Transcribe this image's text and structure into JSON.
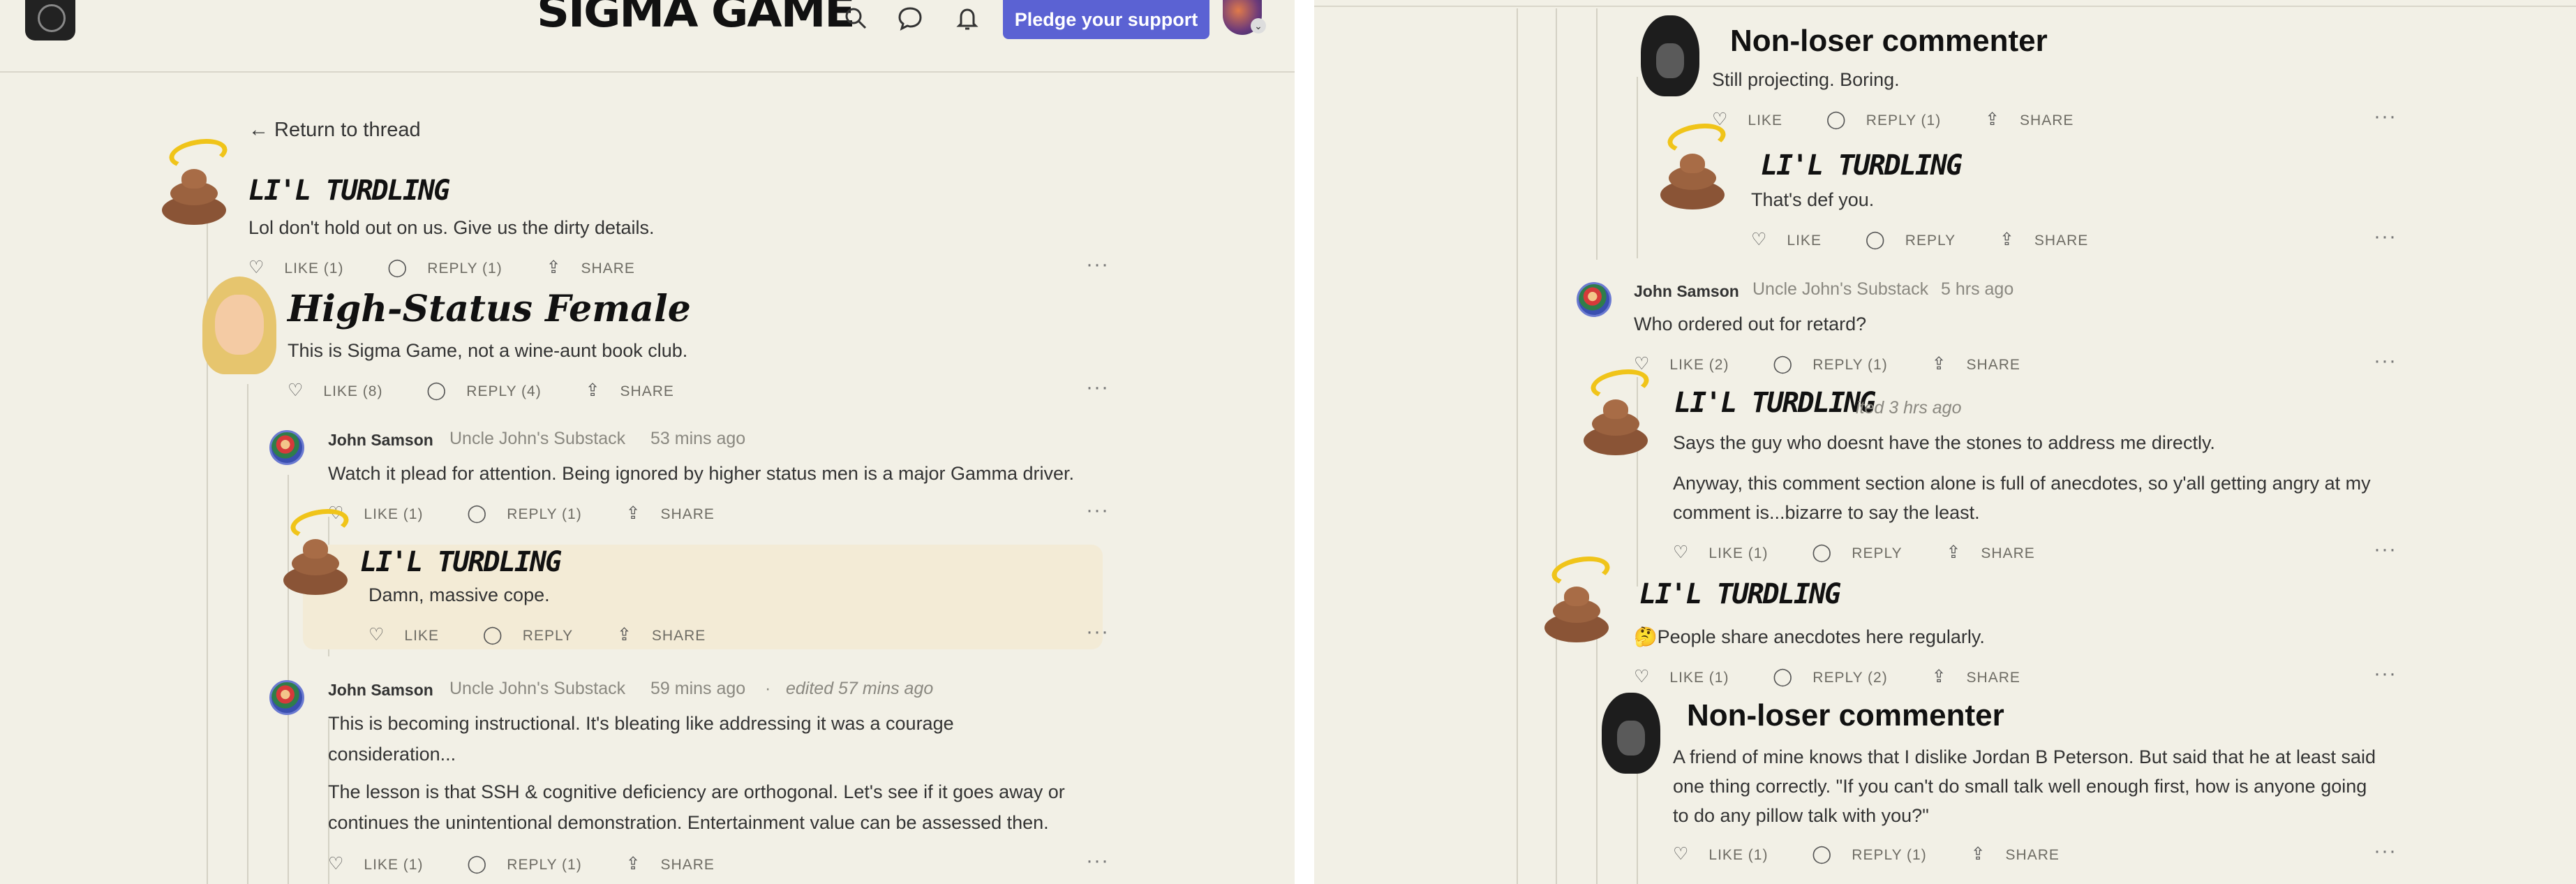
{
  "header": {
    "brand": "SIGMA GAME",
    "pledge_label": "Pledge your support",
    "icons": [
      "search-icon",
      "chat-icon",
      "bell-icon"
    ]
  },
  "back_link": "← Return to thread",
  "left": {
    "c1": {
      "name": "LI'L TURDLING",
      "body": "Lol don't hold out on us. Give us the dirty details.",
      "like": "LIKE (1)",
      "reply": "REPLY (1)",
      "share": "SHARE"
    },
    "c2": {
      "name": "High-Status Female",
      "body": "This is Sigma Game, not a wine-aunt book club.",
      "like": "LIKE (8)",
      "reply": "REPLY (4)",
      "share": "SHARE"
    },
    "c3": {
      "name": "John Samson",
      "pub": "Uncle John's Substack",
      "time": "53 mins ago",
      "body": "Watch it plead for attention. Being ignored by higher status men is a major Gamma driver.",
      "like": "LIKE (1)",
      "reply": "REPLY (1)",
      "share": "SHARE"
    },
    "c4": {
      "name": "LI'L TURDLING",
      "body": "Damn, massive cope.",
      "like": "LIKE",
      "reply": "REPLY",
      "share": "SHARE"
    },
    "c5": {
      "name": "John Samson",
      "pub": "Uncle John's Substack",
      "time": "59 mins ago",
      "sep": "·",
      "edited": "edited 57 mins ago",
      "body1": "This is becoming instructional. It's bleating like addressing it was a courage",
      "body2": "consideration...",
      "body3": "The lesson is that SSH & cognitive deficiency are orthogonal. Let's see if it goes away or",
      "body4": "continues the unintentional demonstration. Entertainment value can be assessed then.",
      "like": "LIKE (1)",
      "reply": "REPLY (1)",
      "share": "SHARE"
    }
  },
  "right": {
    "r1": {
      "name": "Non-loser commenter",
      "body": "Still projecting. Boring.",
      "like": "LIKE",
      "reply": "REPLY (1)",
      "share": "SHARE"
    },
    "r2": {
      "name": "LI'L TURDLING",
      "body": "That's def you.",
      "like": "LIKE",
      "reply": "REPLY",
      "share": "SHARE"
    },
    "r3": {
      "name": "John Samson",
      "pub": "Uncle John's Substack",
      "time": "5 hrs ago",
      "body": "Who ordered out for retard?",
      "like": "LIKE (2)",
      "reply": "REPLY (1)",
      "share": "SHARE"
    },
    "r4": {
      "name": "LI'L TURDLING",
      "edited": "ited 3 hrs ago",
      "body1": "Says the guy who doesnt have the stones to address me directly.",
      "body2": "Anyway, this comment section alone is full of anecdotes, so y'all getting angry at my",
      "body3": "comment is...bizarre to say the least.",
      "like": "LIKE (1)",
      "reply": "REPLY",
      "share": "SHARE"
    },
    "r5": {
      "name": "LI'L TURDLING",
      "body": "🤔People share anecdotes here regularly.",
      "like": "LIKE (1)",
      "reply": "REPLY (2)",
      "share": "SHARE"
    },
    "r6": {
      "name": "Non-loser commenter",
      "body1": "A friend of mine knows that I dislike Jordan B Peterson. But said that he at least said",
      "body2": "one thing correctly. \"If you can't do small talk well enough first, how is anyone going",
      "body3": "to do any pillow talk with you?\"",
      "like": "LIKE (1)",
      "reply": "REPLY (1)",
      "share": "SHARE"
    }
  },
  "more_glyph": "···"
}
